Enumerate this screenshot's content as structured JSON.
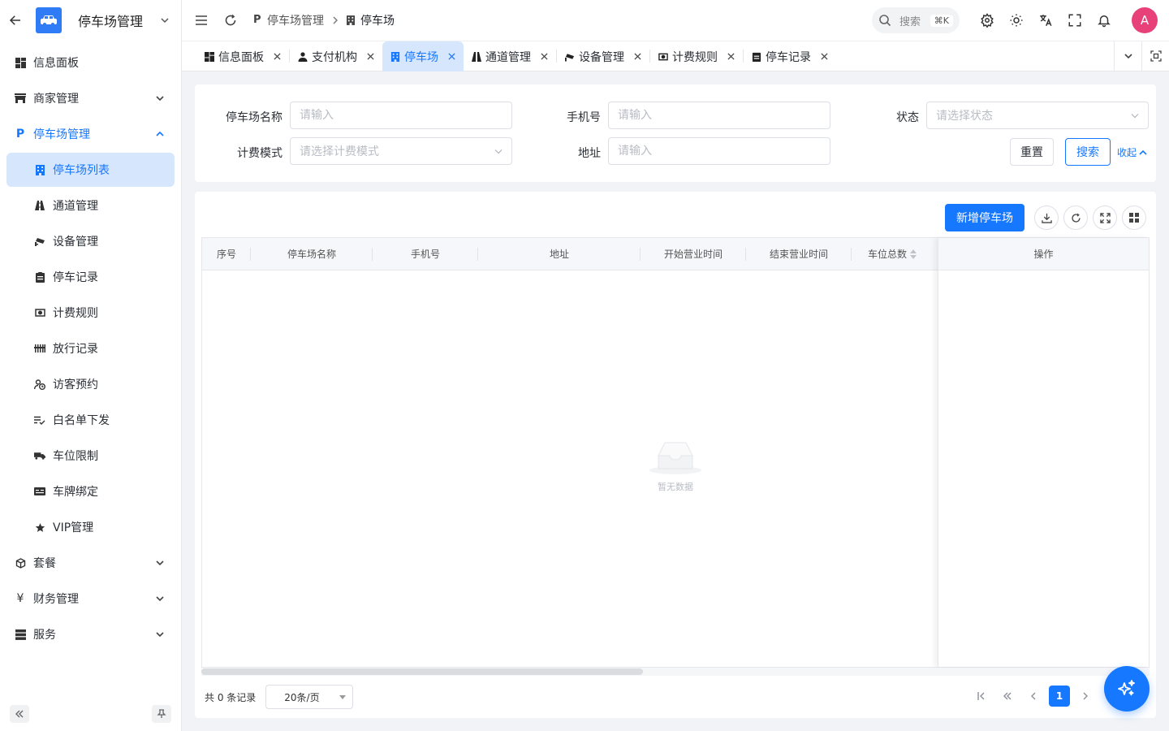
{
  "sidebar": {
    "title": "停车场管理",
    "items": [
      {
        "label": "信息面板"
      },
      {
        "label": "商家管理"
      },
      {
        "label": "停车场管理"
      },
      {
        "label": "停车场列表"
      },
      {
        "label": "通道管理"
      },
      {
        "label": "设备管理"
      },
      {
        "label": "停车记录"
      },
      {
        "label": "计费规则"
      },
      {
        "label": "放行记录"
      },
      {
        "label": "访客预约"
      },
      {
        "label": "白名单下发"
      },
      {
        "label": "车位限制"
      },
      {
        "label": "车牌绑定"
      },
      {
        "label": "VIP管理"
      },
      {
        "label": "套餐"
      },
      {
        "label": "财务管理"
      },
      {
        "label": "服务"
      }
    ]
  },
  "header": {
    "breadcrumb": [
      "停车场管理",
      "停车场"
    ],
    "search_label": "搜索",
    "search_shortcut": "⌘K",
    "avatar_letter": "A"
  },
  "tabs": [
    {
      "label": "信息面板"
    },
    {
      "label": "支付机构"
    },
    {
      "label": "停车场"
    },
    {
      "label": "通道管理"
    },
    {
      "label": "设备管理"
    },
    {
      "label": "计费规则"
    },
    {
      "label": "停车记录"
    }
  ],
  "filter": {
    "name_label": "停车场名称",
    "name_placeholder": "请输入",
    "phone_label": "手机号",
    "phone_placeholder": "请输入",
    "status_label": "状态",
    "status_placeholder": "请选择状态",
    "billing_label": "计费模式",
    "billing_placeholder": "请选择计费模式",
    "address_label": "地址",
    "address_placeholder": "请输入",
    "reset": "重置",
    "search": "搜索",
    "collapse": "收起"
  },
  "table": {
    "add_button": "新增停车场",
    "columns": [
      "序号",
      "停车场名称",
      "手机号",
      "地址",
      "开始营业时间",
      "结束营业时间",
      "车位总数"
    ],
    "action_column": "操作",
    "empty_text": "暂无数据"
  },
  "pager": {
    "total": "共 0 条记录",
    "page_size": "20条/页",
    "current_page": "1"
  },
  "colors": {
    "primary": "#1677ff",
    "active_bg": "#d6e6fc",
    "avatar": "#e8417a"
  }
}
